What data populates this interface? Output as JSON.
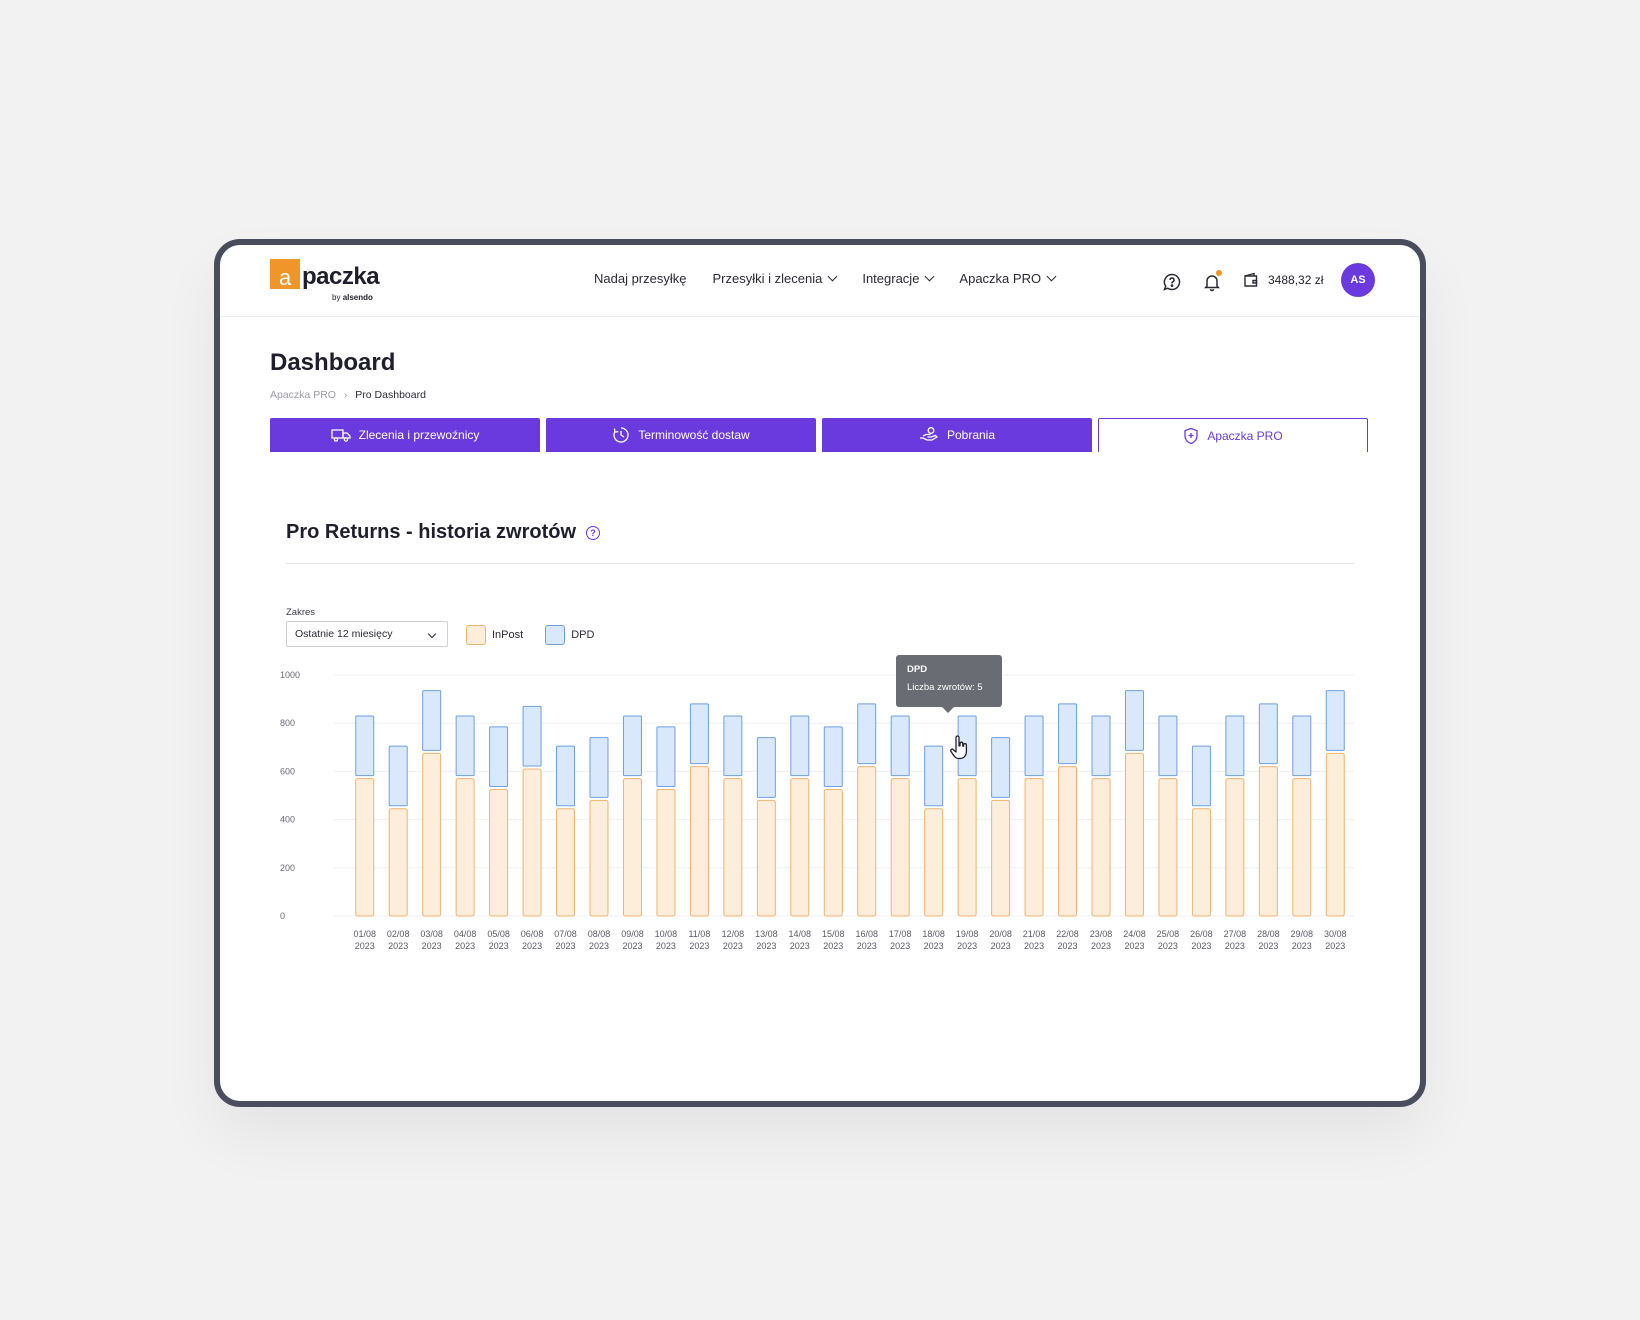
{
  "header": {
    "logo": {
      "letter": "a",
      "text": "paczka",
      "by_prefix": "by",
      "by_brand": "alsendo"
    },
    "nav": [
      {
        "label": "Nadaj przesyłkę",
        "has_dropdown": false
      },
      {
        "label": "Przesyłki i zlecenia",
        "has_dropdown": true
      },
      {
        "label": "Integracje",
        "has_dropdown": true
      },
      {
        "label": "Apaczka PRO",
        "has_dropdown": true
      }
    ],
    "balance": "3488,32 zł",
    "avatar_initials": "AS",
    "has_notification": true
  },
  "page": {
    "title": "Dashboard",
    "breadcrumb": {
      "root": "Apaczka PRO",
      "current": "Pro Dashboard"
    }
  },
  "tabs": [
    {
      "label": "Zlecenia i przewoźnicy",
      "icon": "truck-icon",
      "active": false
    },
    {
      "label": "Terminowość dostaw",
      "icon": "clock-icon",
      "active": false
    },
    {
      "label": "Pobrania",
      "icon": "hand-money-icon",
      "active": false
    },
    {
      "label": "Apaczka PRO",
      "icon": "shield-plus-icon",
      "active": true
    }
  ],
  "section": {
    "title": "Pro Returns - historia zwrotów",
    "help_symbol": "?"
  },
  "filters": {
    "range_label": "Zakres",
    "range_value": "Ostatnie 12 miesięcy"
  },
  "colors": {
    "brand": "#6b3adf",
    "logo_orange": "#f0952a",
    "inpost_fill": "#fdeddb",
    "inpost_stroke": "#f0b36c",
    "dpd_fill": "#dae8fb",
    "dpd_stroke": "#6e9fe0"
  },
  "chart_data": {
    "type": "bar",
    "stacked": true,
    "ylim": [
      0,
      1000
    ],
    "yticks": [
      0,
      200,
      400,
      600,
      800,
      1000
    ],
    "grid": true,
    "legend_position": "top-left",
    "categories": [
      [
        "01/08",
        "2023"
      ],
      [
        "02/08",
        "2023"
      ],
      [
        "03/08",
        "2023"
      ],
      [
        "04/08",
        "2023"
      ],
      [
        "05/08",
        "2023"
      ],
      [
        "06/08",
        "2023"
      ],
      [
        "07/08",
        "2023"
      ],
      [
        "08/08",
        "2023"
      ],
      [
        "09/08",
        "2023"
      ],
      [
        "10/08",
        "2023"
      ],
      [
        "11/08",
        "2023"
      ],
      [
        "12/08",
        "2023"
      ],
      [
        "13/08",
        "2023"
      ],
      [
        "14/08",
        "2023"
      ],
      [
        "15/08",
        "2023"
      ],
      [
        "16/08",
        "2023"
      ],
      [
        "17/08",
        "2023"
      ],
      [
        "18/08",
        "2023"
      ],
      [
        "19/08",
        "2023"
      ],
      [
        "20/08",
        "2023"
      ],
      [
        "21/08",
        "2023"
      ],
      [
        "22/08",
        "2023"
      ],
      [
        "23/08",
        "2023"
      ],
      [
        "24/08",
        "2023"
      ],
      [
        "25/08",
        "2023"
      ],
      [
        "26/08",
        "2023"
      ],
      [
        "27/08",
        "2023"
      ],
      [
        "28/08",
        "2023"
      ],
      [
        "29/08",
        "2023"
      ],
      [
        "30/08",
        "2023"
      ]
    ],
    "series": [
      {
        "name": "InPost",
        "values": [
          570,
          445,
          675,
          570,
          525,
          610,
          445,
          480,
          570,
          525,
          620,
          570,
          480,
          570,
          525,
          620,
          570,
          445,
          570,
          480,
          570,
          620,
          570,
          675,
          570,
          445,
          570,
          620,
          570,
          675
        ]
      },
      {
        "name": "DPD",
        "values": [
          260,
          260,
          260,
          260,
          260,
          260,
          260,
          260,
          260,
          260,
          260,
          260,
          260,
          260,
          260,
          260,
          260,
          260,
          260,
          260,
          260,
          260,
          260,
          260,
          260,
          260,
          260,
          260,
          260,
          260
        ]
      }
    ],
    "tooltip": {
      "series": "DPD",
      "text": "Liczba zwrotów: 5",
      "category_index": 18
    }
  }
}
